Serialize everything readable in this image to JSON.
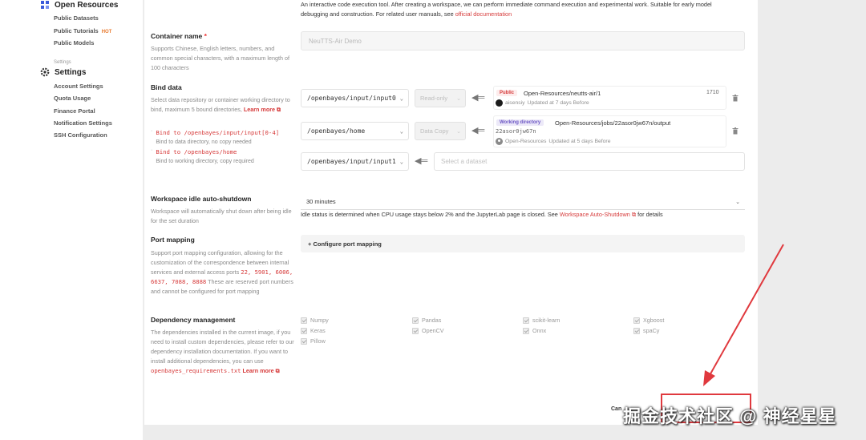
{
  "sidebar": {
    "open_resources": {
      "title": "Open Resources",
      "items": [
        {
          "label": "Public Datasets"
        },
        {
          "label": "Public Tutorials",
          "badge": "HOT"
        },
        {
          "label": "Public Models"
        }
      ]
    },
    "settings_group_label": "Settings",
    "settings": {
      "title": "Settings",
      "items": [
        {
          "label": "Account Settings"
        },
        {
          "label": "Quota Usage"
        },
        {
          "label": "Finance Portal"
        },
        {
          "label": "Notification Settings"
        },
        {
          "label": "SSH Configuration"
        }
      ]
    }
  },
  "intro": {
    "text": "An interactive code execution tool. After creating a workspace, we can perform immediate command execution and experimental work. Suitable for early model debugging and construction. For related user manuals, see",
    "link": "official documentation"
  },
  "container_name": {
    "label": "Container name",
    "required_mark": "*",
    "description": "Supports Chinese, English letters, numbers, and common special characters, with a maximum length of 100 characters",
    "value": "NeuTTS-Air Demo"
  },
  "bind_data": {
    "label": "Bind data",
    "description": "Select data repository or container working directory to bind, maximum 5 bound directories,",
    "learn_more": "Learn more",
    "hints": [
      {
        "path": "Bind to /openbayes/input/input[0-4]",
        "note": "Bind to data directory, no copy needed"
      },
      {
        "path": "Bind to /openbayes/home",
        "note": "Bind to working directory, copy required"
      }
    ],
    "rows": [
      {
        "path": "/openbayes/input/input0",
        "mode": "Read-only",
        "badge": "Public",
        "name": "Open-Resources/neutts-air/1",
        "size": "1710",
        "owner": "aisensiy",
        "updated": "Updated at 7 days Before"
      },
      {
        "path": "/openbayes/home",
        "mode": "Data Copy",
        "badge": "Working directory",
        "name": "Open-Resources/jobs/22asor0jw67n/output",
        "job_id": "22asor0jw67n",
        "owner": "Open-Resources",
        "updated": "Updated at 5 days Before"
      },
      {
        "path": "/openbayes/input/input1",
        "placeholder": "Select a dataset"
      }
    ]
  },
  "idle_shutdown": {
    "label": "Workspace idle auto-shutdown",
    "description": "Workspace will automatically shut down after being idle for the set duration",
    "value": "30 minutes",
    "status_text": "Idle status is determined when CPU usage stays below 2% and the JupyterLab page is closed. See",
    "status_link": "Workspace Auto-Shutdown",
    "status_suffix": "for details"
  },
  "port_mapping": {
    "label": "Port mapping",
    "description_1": "Support port mapping configuration, allowing for the customization of the correspondence between internal services and external access ports",
    "ports": "22, 5901, 6006, 6637, 7088, 8888",
    "description_2": "These are reserved port numbers and cannot be configured for port mapping",
    "button": "+ Configure port mapping"
  },
  "dependency": {
    "label": "Dependency management",
    "description": "The dependencies installed in the current image, if you need to install custom dependencies, please refer to our dependency installation documentation. If you want to install additional dependencies, you can use",
    "file": "openbayes_requirements.txt",
    "learn_more": "Learn more",
    "packages": [
      "Numpy",
      "Pandas",
      "scikit-learn",
      "Xgboost",
      "Keras",
      "OpenCV",
      "Onnx",
      "spaCy",
      "Pillow"
    ]
  },
  "footer": {
    "cancel": "Can"
  },
  "watermark": "掘金技术社区 @ 神经星星",
  "colors": {
    "accent": "#d63a3a",
    "annotation": "#e0393e"
  }
}
